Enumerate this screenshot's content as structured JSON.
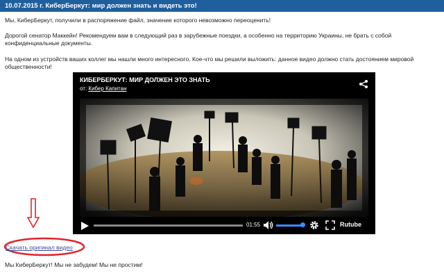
{
  "header": {
    "title": "10.07.2015 г. КиберБеркут: мир должен знать и видеть это!"
  },
  "article": {
    "p1": "Мы, КиберБеркут, получили в распоряжение файл, значение которого невозможно переоценить!",
    "p2": "Дорогой сенатор Маккейн! Рекомендуем вам в следующий раз в зарубежные поездки, а особенно на территорию Украины, не брать с собой конфиденциальные документы.",
    "p3": "На одном из устройств ваших коллег мы нашли много интересного. Кое-что мы решили выложить: данное видео должно стать достоянием мировой общественности!",
    "download_link": "Скачать оригинал видео",
    "closing": "Мы КиберБеркут! Мы не забудем! Мы не простим!"
  },
  "video": {
    "title": "КИБЕРБЕРКУТ: МИР ДОЛЖЕН ЭТО ЗНАТЬ",
    "author_prefix": "от:",
    "author_name": "Кибер Капитан",
    "time": "01:55",
    "brand": "Rutube"
  },
  "colors": {
    "header_bg": "#1f5f9e",
    "annotation": "#e0242b",
    "volume_accent": "#3b8cff",
    "link": "#3b4a99"
  },
  "icons": [
    "share-icon",
    "play-icon",
    "volume-icon",
    "gear-icon",
    "fullscreen-icon"
  ]
}
